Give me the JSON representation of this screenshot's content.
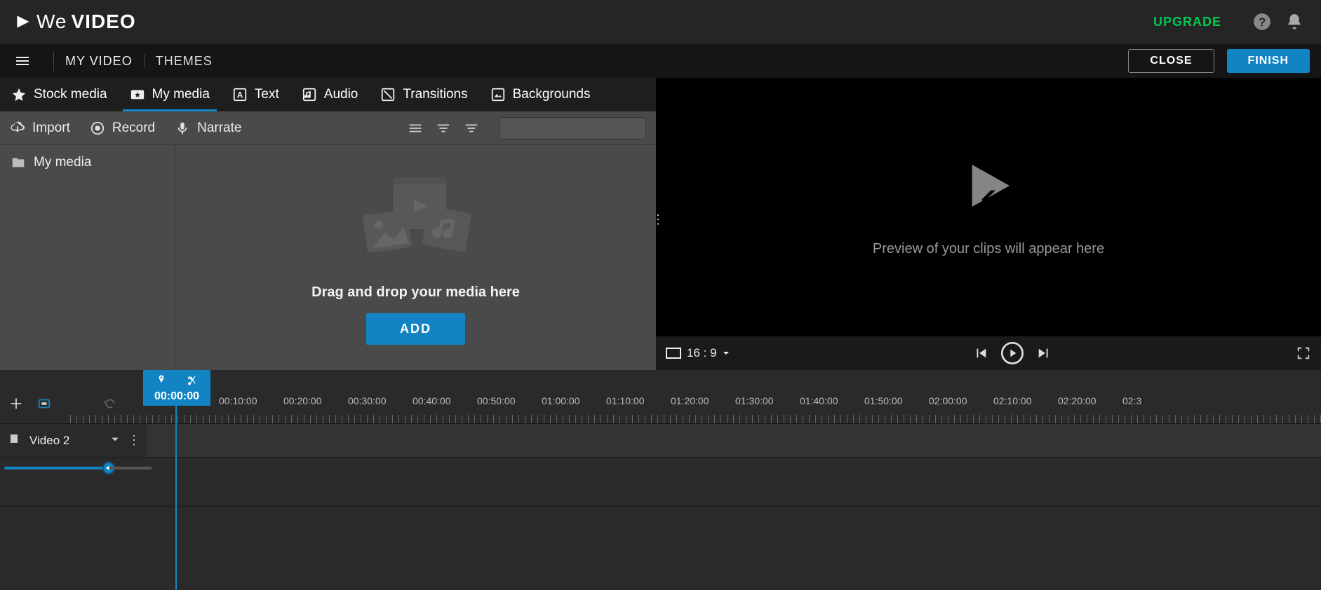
{
  "header": {
    "upgrade": "UPGRADE"
  },
  "subheader": {
    "project_name": "MY VIDEO",
    "themes": "THEMES",
    "close": "CLOSE",
    "finish": "FINISH"
  },
  "media_tabs": {
    "stock": "Stock media",
    "my": "My media",
    "text": "Text",
    "audio": "Audio",
    "transitions": "Transitions",
    "backgrounds": "Backgrounds"
  },
  "actions": {
    "import": "Import",
    "record": "Record",
    "narrate": "Narrate",
    "search_placeholder": ""
  },
  "folder": {
    "my_media": "My media"
  },
  "drop": {
    "text": "Drag and drop your media here",
    "add": "ADD"
  },
  "preview": {
    "placeholder": "Preview of your clips will appear here",
    "aspect": "16 : 9"
  },
  "timeline": {
    "playhead_time": "00:00:00",
    "labels": [
      "00:10:00",
      "00:20:00",
      "00:30:00",
      "00:40:00",
      "00:50:00",
      "01:00:00",
      "01:10:00",
      "01:20:00",
      "01:30:00",
      "01:40:00",
      "01:50:00",
      "02:00:00",
      "02:10:00",
      "02:20:00",
      "02:3"
    ],
    "track_name": "Video 2"
  }
}
